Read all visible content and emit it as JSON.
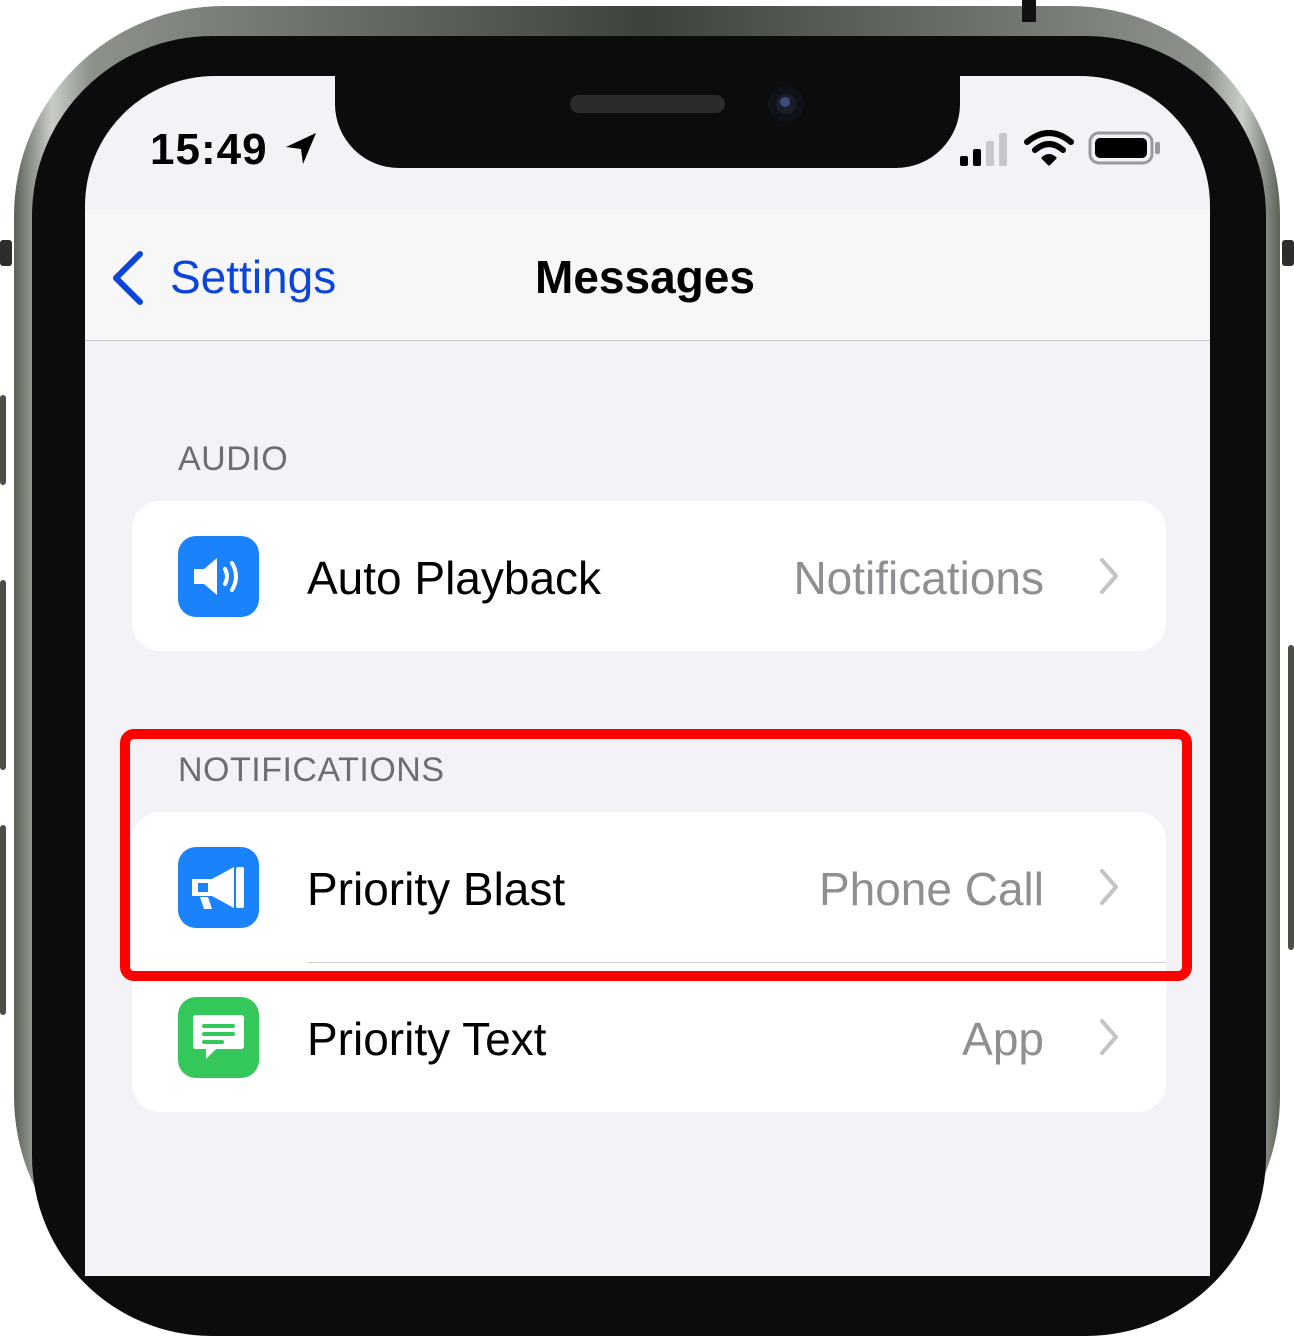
{
  "status_bar": {
    "time": "15:49"
  },
  "nav": {
    "back_label": "Settings",
    "title": "Messages"
  },
  "sections": [
    {
      "header": "AUDIO",
      "rows": [
        {
          "label": "Auto Playback",
          "value": "Notifications",
          "icon": "speaker-icon",
          "icon_color": "#1a82fb"
        }
      ]
    },
    {
      "header": "NOTIFICATIONS",
      "rows": [
        {
          "label": "Priority Blast",
          "value": "Phone Call",
          "icon": "megaphone-icon",
          "icon_color": "#1a82fb"
        },
        {
          "label": "Priority Text",
          "value": "App",
          "icon": "message-bubble-icon",
          "icon_color": "#34c759"
        }
      ]
    }
  ],
  "colors": {
    "accent": "#0b45d9",
    "highlight": "#ff0000",
    "background": "#f2f2f7"
  }
}
